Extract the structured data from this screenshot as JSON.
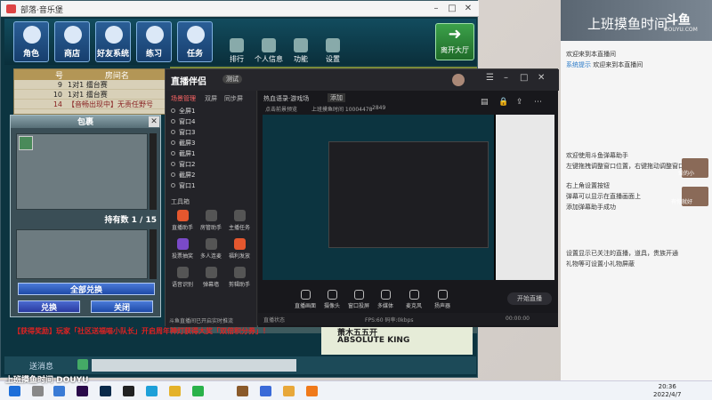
{
  "game": {
    "window_title": "部落·音乐堡",
    "toolbar": [
      {
        "label": "角色",
        "icon": "character-icon"
      },
      {
        "label": "商店",
        "icon": "shop-icon"
      },
      {
        "label": "好友系统",
        "icon": "friends-icon"
      },
      {
        "label": "练习",
        "icon": "practice-icon"
      },
      {
        "label": "任务",
        "icon": "task-icon"
      }
    ],
    "small_tools": [
      {
        "label": "排行",
        "icon": "ranking-icon"
      },
      {
        "label": "个人信息",
        "icon": "profile-icon"
      },
      {
        "label": "功能",
        "icon": "function-icon"
      },
      {
        "label": "设置",
        "icon": "settings-icon"
      }
    ],
    "exit_label": "离开大厅",
    "room_panel": {
      "col_no": "号",
      "col_name": "房间名",
      "rows": [
        {
          "no": "9",
          "name": "1对1 擂台赛"
        },
        {
          "no": "10",
          "name": "1对1 擂台赛"
        },
        {
          "no": "14",
          "name": "【音畅出现中】无责任野号"
        }
      ]
    },
    "bag": {
      "title": "包裹",
      "count_label": "持有数 1 / 15",
      "exchange_all": "全部兑换",
      "exchange": "兑换",
      "close": "关闭"
    },
    "chat_line": "【获得奖励】玩家「社区送福喵小队长」开启周年神灯获得大奖「双倍积分券」！",
    "players": [
      "萧木五五开",
      "ABSOLUTE KING"
    ],
    "input_label": "送消息"
  },
  "companion": {
    "logo": "直播伴侣",
    "badge": "测试",
    "tabs": [
      "场景管理",
      "双屏",
      "同步屏"
    ],
    "scenes": [
      "全屏1",
      "窗口4",
      "窗口3",
      "截屏3",
      "截屏1",
      "窗口2",
      "截屏2",
      "窗口1"
    ],
    "tools_header": "工具箱",
    "tools": [
      {
        "label": "直播助手",
        "icon": "assistant-icon"
      },
      {
        "label": "房管助手",
        "icon": "admin-icon"
      },
      {
        "label": "主播任务",
        "icon": "mission-icon"
      },
      {
        "label": "投票抽奖",
        "icon": "vote-icon"
      },
      {
        "label": "多人连麦",
        "icon": "mic-link-icon"
      },
      {
        "label": "福利发放",
        "icon": "gift-icon"
      },
      {
        "label": "语音识别",
        "icon": "voice-icon"
      },
      {
        "label": "弹幕墙",
        "icon": "danmaku-icon"
      },
      {
        "label": "剪辑助手",
        "icon": "edit-icon"
      }
    ],
    "note": "斗鱼直播间已开启实时推流",
    "preview_tabs": [
      "热血语录·游戏场",
      "添加"
    ],
    "preview_info": [
      "点击前景预览",
      "上班摸鱼时间 10004478",
      "2849"
    ],
    "controls": [
      {
        "label": "直播画面",
        "icon": "screen-icon"
      },
      {
        "label": "摄像头",
        "icon": "camera-icon"
      },
      {
        "label": "窗口投屏",
        "icon": "window-icon"
      },
      {
        "label": "多媒体",
        "icon": "media-icon"
      },
      {
        "label": "麦克风",
        "icon": "mic-icon"
      },
      {
        "label": "扬声器",
        "icon": "speaker-icon"
      }
    ],
    "start_label": "开始直播",
    "status_left": "直播状态",
    "status_mid": "FPS:60 码率:0kbps",
    "timer": "00:00:00"
  },
  "chat": {
    "banner_title": "上班摸鱼时间",
    "brand": "斗鱼",
    "brand_sub": "DOUYU.COM",
    "messages": [
      {
        "nick": "",
        "text": "欢迎来到本直播间"
      },
      {
        "nick": "系统提示",
        "text": "欢迎来到本直播间"
      },
      {
        "nick": "",
        "text": "欢迎使用斗鱼弹幕助手"
      },
      {
        "nick": "",
        "text": "左键拖拽调整窗口位置，右键拖动调整窗口大小"
      },
      {
        "nick": "",
        "text": "右上角设置按钮"
      },
      {
        "nick": "",
        "text": "弹幕可以显示在直播画面上"
      },
      {
        "nick": "",
        "text": "添加弹幕助手成功"
      },
      {
        "nick": "",
        "text": "设置显示已关注的直播，道具，贵族开通"
      },
      {
        "nick": "",
        "text": "礼物等可设置小礼物屏蔽"
      }
    ],
    "side_labels": [
      "爱的小",
      "有你就好"
    ]
  },
  "taskbar": {
    "time": "20:36",
    "date": "2022/4/7",
    "apps": [
      "windows-start-icon",
      "search-icon",
      "store-icon",
      "premiere-icon",
      "photoshop-icon",
      "qq-icon",
      "edge-icon",
      "chrome-icon",
      "wechat-icon",
      "game-icon",
      "feishu-icon",
      "folder-icon",
      "douyu-icon"
    ]
  },
  "watermark": "上班摸鱼时间 DOUYU"
}
